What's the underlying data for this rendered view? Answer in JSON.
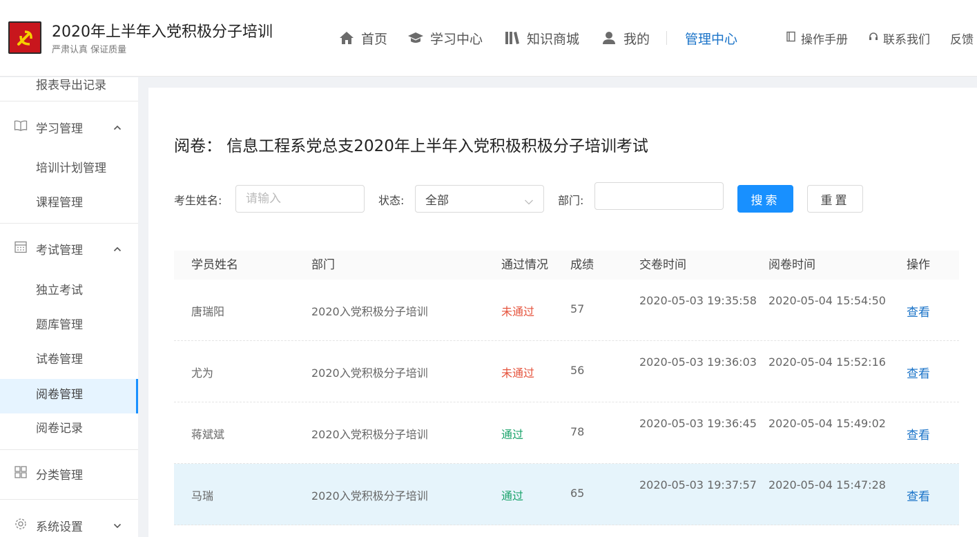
{
  "header": {
    "title": "2020年上半年入党积极分子培训",
    "subtitle": "严肃认真 保证质量",
    "nav": [
      {
        "label": "首页"
      },
      {
        "label": "学习中心"
      },
      {
        "label": "知识商城"
      },
      {
        "label": "我的"
      },
      {
        "label": "管理中心"
      }
    ],
    "utils": [
      {
        "label": "操作手册"
      },
      {
        "label": "联系我们"
      },
      {
        "label": "反馈"
      }
    ],
    "active_color": "#1a73c8"
  },
  "sidebar": {
    "top_item": "报表导出记录",
    "study_group": "学习管理",
    "study_items": [
      "培训计划管理",
      "课程管理"
    ],
    "exam_group": "考试管理",
    "exam_items": [
      "独立考试",
      "题库管理",
      "试卷管理",
      "阅卷管理",
      "阅卷记录"
    ],
    "active_item": "阅卷管理",
    "category_group": "分类管理",
    "settings_group": "系统设置"
  },
  "main": {
    "heading": "阅卷： 信息工程系党总支2020年上半年入党积极积极分子培训考试",
    "filters": {
      "name_label": "考生姓名:",
      "name_placeholder": "请输入",
      "status_label": "状态:",
      "status_value": "全部",
      "dept_label": "部门:",
      "dept_value": "",
      "search_button": "搜索",
      "reset_button": "重置"
    },
    "table": {
      "headers": [
        "学员姓名",
        "部门",
        "通过情况",
        "成绩",
        "交卷时间",
        "阅卷时间",
        "操作"
      ],
      "rows": [
        {
          "name": "唐瑞阳",
          "dept": "2020入党积极分子培训",
          "status": "未通过",
          "score": "57",
          "submit_time": "2020-05-03 19:35:58",
          "review_time": "2020-05-04 15:54:50",
          "action": "查看"
        },
        {
          "name": "尤为",
          "dept": "2020入党积极分子培训",
          "status": "未通过",
          "score": "56",
          "submit_time": "2020-05-03 19:36:03",
          "review_time": "2020-05-04 15:52:16",
          "action": "查看"
        },
        {
          "name": "蒋斌斌",
          "dept": "2020入党积极分子培训",
          "status": "通过",
          "score": "78",
          "submit_time": "2020-05-03 19:36:45",
          "review_time": "2020-05-04 15:49:02",
          "action": "查看"
        },
        {
          "name": "马瑞",
          "dept": "2020入党积极分子培训",
          "status": "通过",
          "score": "65",
          "submit_time": "2020-05-03 19:37:57",
          "review_time": "2020-05-04 15:47:28",
          "action": "查看"
        }
      ]
    },
    "status_colors": {
      "fail": "#e5533c",
      "pass": "#1aa36b"
    }
  }
}
